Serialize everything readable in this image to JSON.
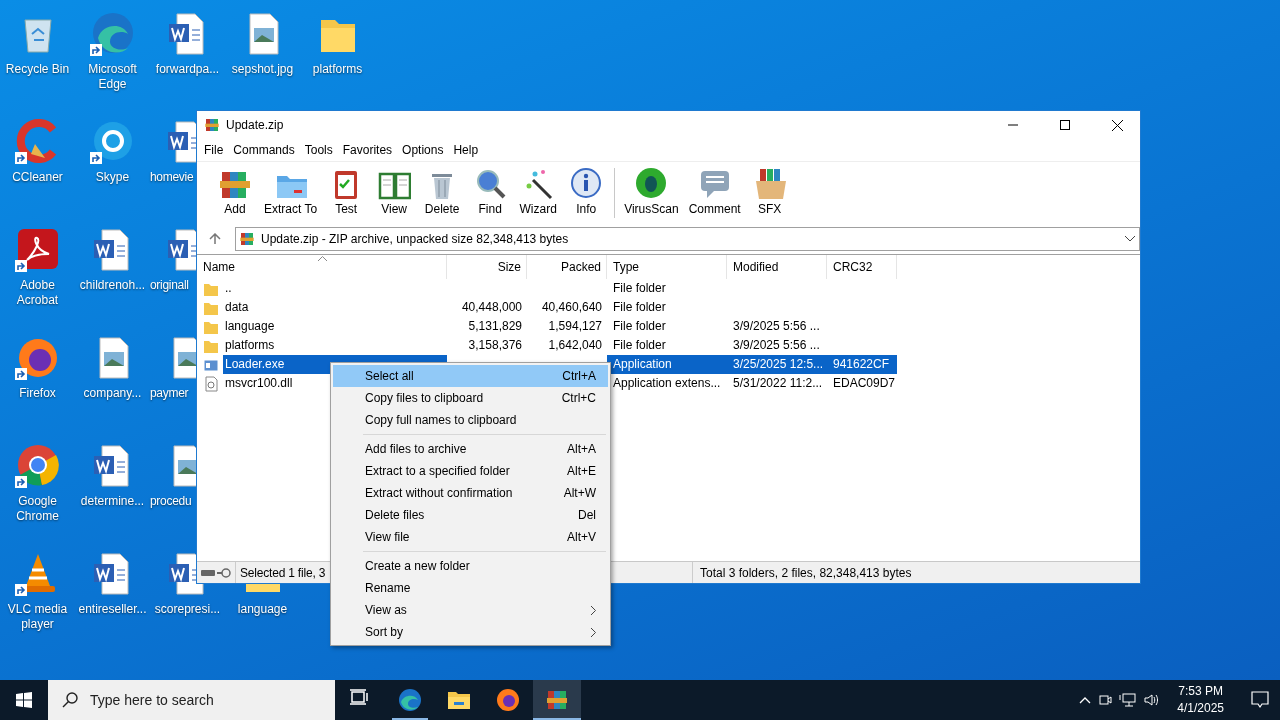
{
  "desktop": {
    "rows": [
      [
        {
          "label": "Recycle Bin",
          "kind": "recycle",
          "shortcut": false
        },
        {
          "label": "Microsoft Edge",
          "kind": "edge",
          "shortcut": true
        },
        {
          "label": "forwardpa...",
          "kind": "word",
          "shortcut": false
        },
        {
          "label": "sepshot.jpg",
          "kind": "image",
          "shortcut": false
        },
        {
          "label": "platforms",
          "kind": "folder",
          "shortcut": false
        }
      ],
      [
        {
          "label": "CCleaner",
          "kind": "ccleaner",
          "shortcut": true
        },
        {
          "label": "Skype",
          "kind": "skype",
          "shortcut": true
        },
        {
          "label": "homevie",
          "kind": "word",
          "shortcut": false
        }
      ],
      [
        {
          "label": "Adobe Acrobat",
          "kind": "acrobat",
          "shortcut": true
        },
        {
          "label": "childrenoh...",
          "kind": "word",
          "shortcut": false
        },
        {
          "label": "originall",
          "kind": "word",
          "shortcut": false
        }
      ],
      [
        {
          "label": "Firefox",
          "kind": "firefox",
          "shortcut": true
        },
        {
          "label": "company...",
          "kind": "image",
          "shortcut": false
        },
        {
          "label": "paymer",
          "kind": "image",
          "shortcut": false
        }
      ],
      [
        {
          "label": "Google Chrome",
          "kind": "chrome",
          "shortcut": true
        },
        {
          "label": "determine...",
          "kind": "word",
          "shortcut": false
        },
        {
          "label": "procedu",
          "kind": "image",
          "shortcut": false
        }
      ],
      [
        {
          "label": "VLC media player",
          "kind": "vlc",
          "shortcut": true
        },
        {
          "label": "entireseller...",
          "kind": "word",
          "shortcut": false
        },
        {
          "label": "scorepresi...",
          "kind": "word",
          "shortcut": false
        },
        {
          "label": "language",
          "kind": "folder",
          "shortcut": false
        }
      ]
    ]
  },
  "window": {
    "title": "Update.zip",
    "menu": [
      "File",
      "Commands",
      "Tools",
      "Favorites",
      "Options",
      "Help"
    ],
    "toolbar_groups": [
      [
        {
          "label": "Add",
          "kind": "add"
        },
        {
          "label": "Extract To",
          "kind": "extract"
        },
        {
          "label": "Test",
          "kind": "test"
        },
        {
          "label": "View",
          "kind": "view"
        },
        {
          "label": "Delete",
          "kind": "delete"
        },
        {
          "label": "Find",
          "kind": "find"
        },
        {
          "label": "Wizard",
          "kind": "wizard"
        },
        {
          "label": "Info",
          "kind": "info"
        }
      ],
      [
        {
          "label": "VirusScan",
          "kind": "virus"
        },
        {
          "label": "Comment",
          "kind": "comment"
        },
        {
          "label": "SFX",
          "kind": "sfx"
        }
      ]
    ],
    "address": "Update.zip - ZIP archive, unpacked size 82,348,413 bytes",
    "columns": [
      {
        "label": "Name",
        "sorted": true
      },
      {
        "label": "Size",
        "sorted": false
      },
      {
        "label": "Packed",
        "sorted": false
      },
      {
        "label": "Type",
        "sorted": false
      },
      {
        "label": "Modified",
        "sorted": false
      },
      {
        "label": "CRC32",
        "sorted": false
      }
    ],
    "files": [
      {
        "kind": "folder",
        "name": "..",
        "type": "File folder",
        "selected": false
      },
      {
        "kind": "folder",
        "name": "data",
        "size": "40,448,000",
        "packed": "40,460,640",
        "type": "File folder",
        "selected": false
      },
      {
        "kind": "folder",
        "name": "language",
        "size": "5,131,829",
        "packed": "1,594,127",
        "type": "File folder",
        "modified": "3/9/2025 5:56 ...",
        "selected": false
      },
      {
        "kind": "folder",
        "name": "platforms",
        "size": "3,158,376",
        "packed": "1,642,040",
        "type": "File folder",
        "modified": "3/9/2025 5:56 ...",
        "selected": false
      },
      {
        "kind": "exe",
        "name": "Loader.exe",
        "type": "Application",
        "modified": "3/25/2025 12:5...",
        "crc": "941622CF",
        "selected": true
      },
      {
        "kind": "dll",
        "name": "msvcr100.dll",
        "type": "Application extens...",
        "modified": "5/31/2022 11:2...",
        "crc": "EDAC09D7",
        "selected": false
      }
    ],
    "status_left": "Selected 1 file, 3",
    "status_right": "Total 3 folders, 2 files, 82,348,413 bytes"
  },
  "context_menu": {
    "groups": [
      [
        {
          "label": "Select all",
          "shortcut": "Ctrl+A",
          "submenu": false,
          "selected": true
        },
        {
          "label": "Copy files to clipboard",
          "shortcut": "Ctrl+C",
          "submenu": false,
          "selected": false
        },
        {
          "label": "Copy full names to clipboard",
          "submenu": false,
          "selected": false
        }
      ],
      [
        {
          "label": "Add files to archive",
          "shortcut": "Alt+A",
          "submenu": false,
          "selected": false
        },
        {
          "label": "Extract to a specified folder",
          "shortcut": "Alt+E",
          "submenu": false,
          "selected": false
        },
        {
          "label": "Extract without confirmation",
          "shortcut": "Alt+W",
          "submenu": false,
          "selected": false
        },
        {
          "label": "Delete files",
          "shortcut": "Del",
          "submenu": false,
          "selected": false
        },
        {
          "label": "View file",
          "shortcut": "Alt+V",
          "submenu": false,
          "selected": false
        }
      ],
      [
        {
          "label": "Create a new folder",
          "submenu": false,
          "selected": false
        },
        {
          "label": "Rename",
          "submenu": false,
          "selected": false
        },
        {
          "label": "View as",
          "submenu": true,
          "selected": false
        },
        {
          "label": "Sort by",
          "submenu": true,
          "selected": false
        }
      ]
    ]
  },
  "taskbar": {
    "search_placeholder": "Type here to search",
    "apps": [
      {
        "kind": "taskview",
        "running": false,
        "active": false
      },
      {
        "kind": "edge",
        "running": true,
        "active": false
      },
      {
        "kind": "explorer",
        "running": false,
        "active": false
      },
      {
        "kind": "firefox",
        "running": false,
        "active": false
      },
      {
        "kind": "winrar",
        "running": true,
        "active": true
      }
    ],
    "time": "7:53 PM",
    "date": "4/1/2025"
  }
}
